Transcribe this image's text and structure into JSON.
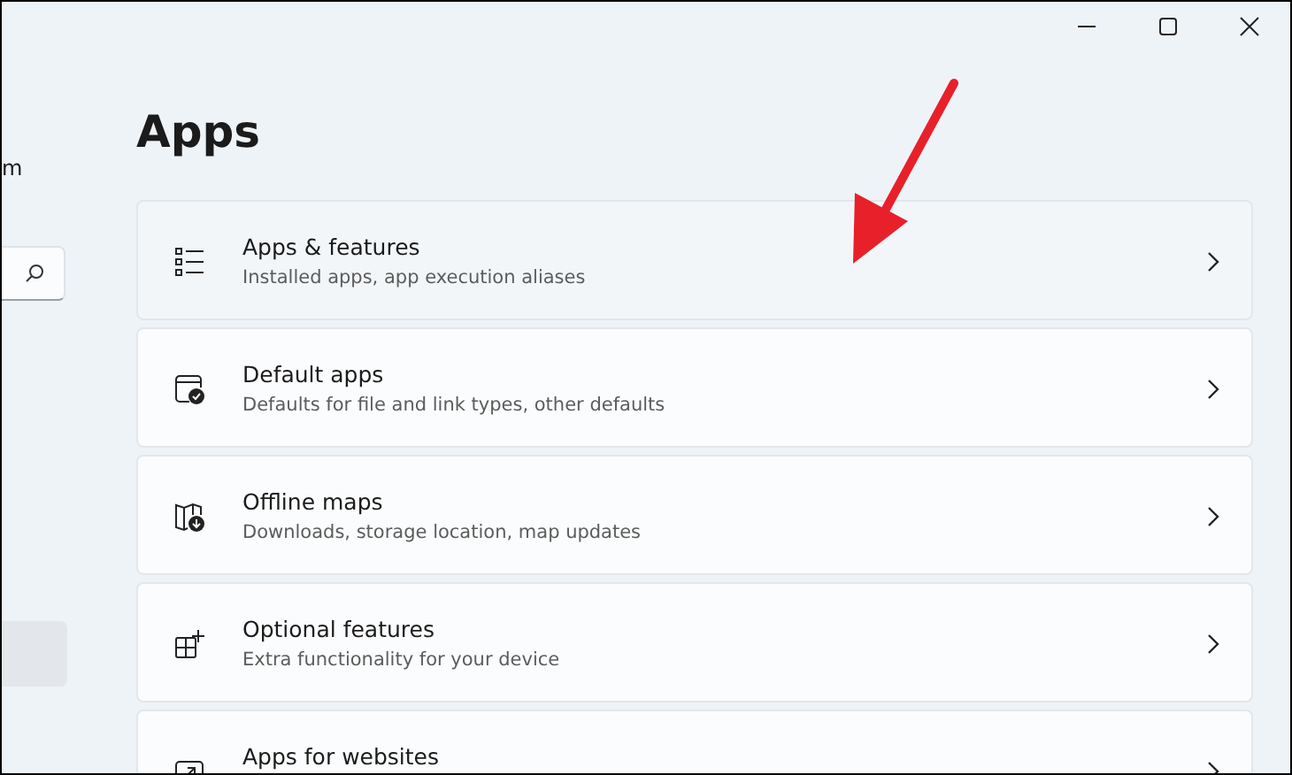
{
  "sidebar": {
    "title_fragment": "m",
    "items": [
      {
        "selected": true
      }
    ]
  },
  "page": {
    "title": "Apps"
  },
  "cards": [
    {
      "kind": "list",
      "title": "Apps & features",
      "subtitle": "Installed apps, app execution aliases"
    },
    {
      "kind": "default",
      "title": "Default apps",
      "subtitle": "Defaults for file and link types, other defaults"
    },
    {
      "kind": "map",
      "title": "Offline maps",
      "subtitle": "Downloads, storage location, map updates"
    },
    {
      "kind": "optional",
      "title": "Optional features",
      "subtitle": "Extra functionality for your device"
    },
    {
      "kind": "web",
      "title": "Apps for websites"
    }
  ]
}
